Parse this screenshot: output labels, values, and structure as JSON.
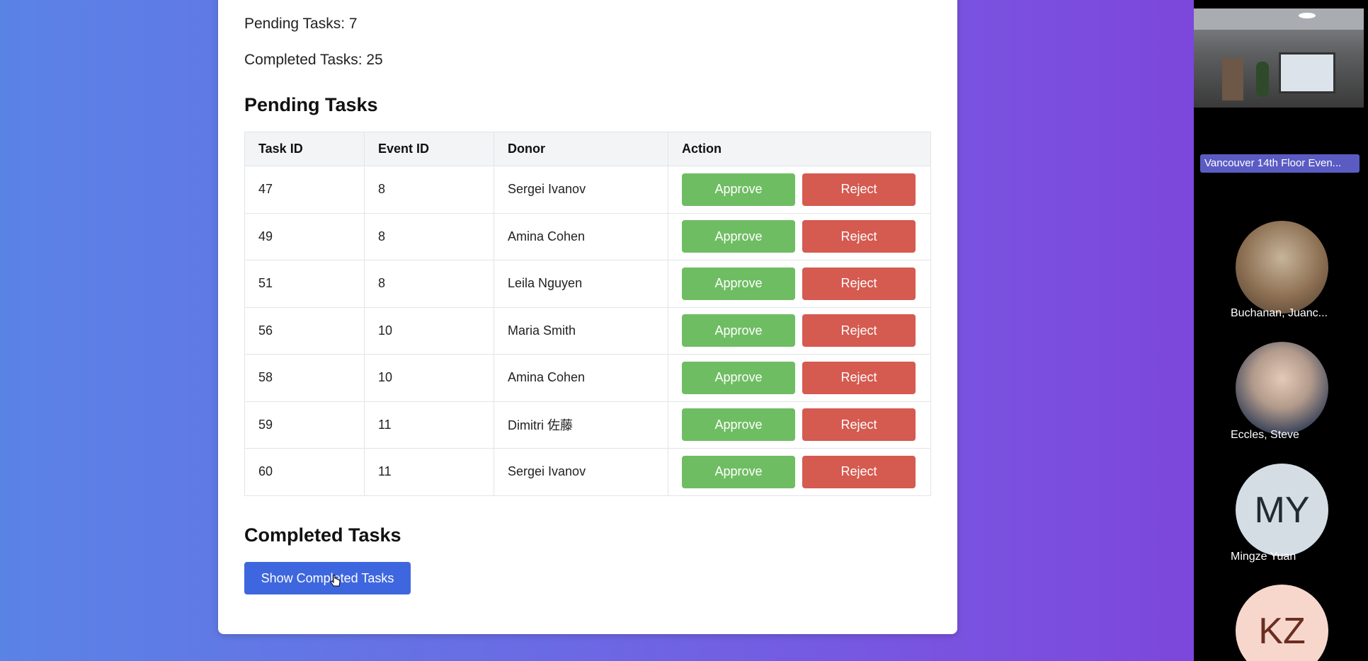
{
  "stats": {
    "pending": "Pending Tasks: 7",
    "completed": "Completed Tasks: 25"
  },
  "sections": {
    "pending_title": "Pending Tasks",
    "completed_title": "Completed Tasks"
  },
  "table": {
    "headers": [
      "Task ID",
      "Event ID",
      "Donor",
      "Action"
    ],
    "rows": [
      {
        "task_id": "47",
        "event_id": "8",
        "donor": "Sergei Ivanov"
      },
      {
        "task_id": "49",
        "event_id": "8",
        "donor": "Amina Cohen"
      },
      {
        "task_id": "51",
        "event_id": "8",
        "donor": "Leila Nguyen"
      },
      {
        "task_id": "56",
        "event_id": "10",
        "donor": "Maria Smith"
      },
      {
        "task_id": "58",
        "event_id": "10",
        "donor": "Amina Cohen"
      },
      {
        "task_id": "59",
        "event_id": "11",
        "donor": "Dimitri 佐藤"
      },
      {
        "task_id": "60",
        "event_id": "11",
        "donor": "Sergei Ivanov"
      }
    ],
    "approve_label": "Approve",
    "reject_label": "Reject"
  },
  "show_completed_label": "Show Completed Tasks",
  "meeting": {
    "room_label": "Vancouver 14th Floor Even...",
    "participants": [
      {
        "name": "Buchanan, Juanc..."
      },
      {
        "name": "Eccles, Steve"
      },
      {
        "name": "Mingze Yuan",
        "initials": "MY"
      },
      {
        "initials": "KZ"
      }
    ]
  },
  "colors": {
    "approve": "#6fbd63",
    "reject": "#d55a50",
    "primary": "#3e67df"
  }
}
